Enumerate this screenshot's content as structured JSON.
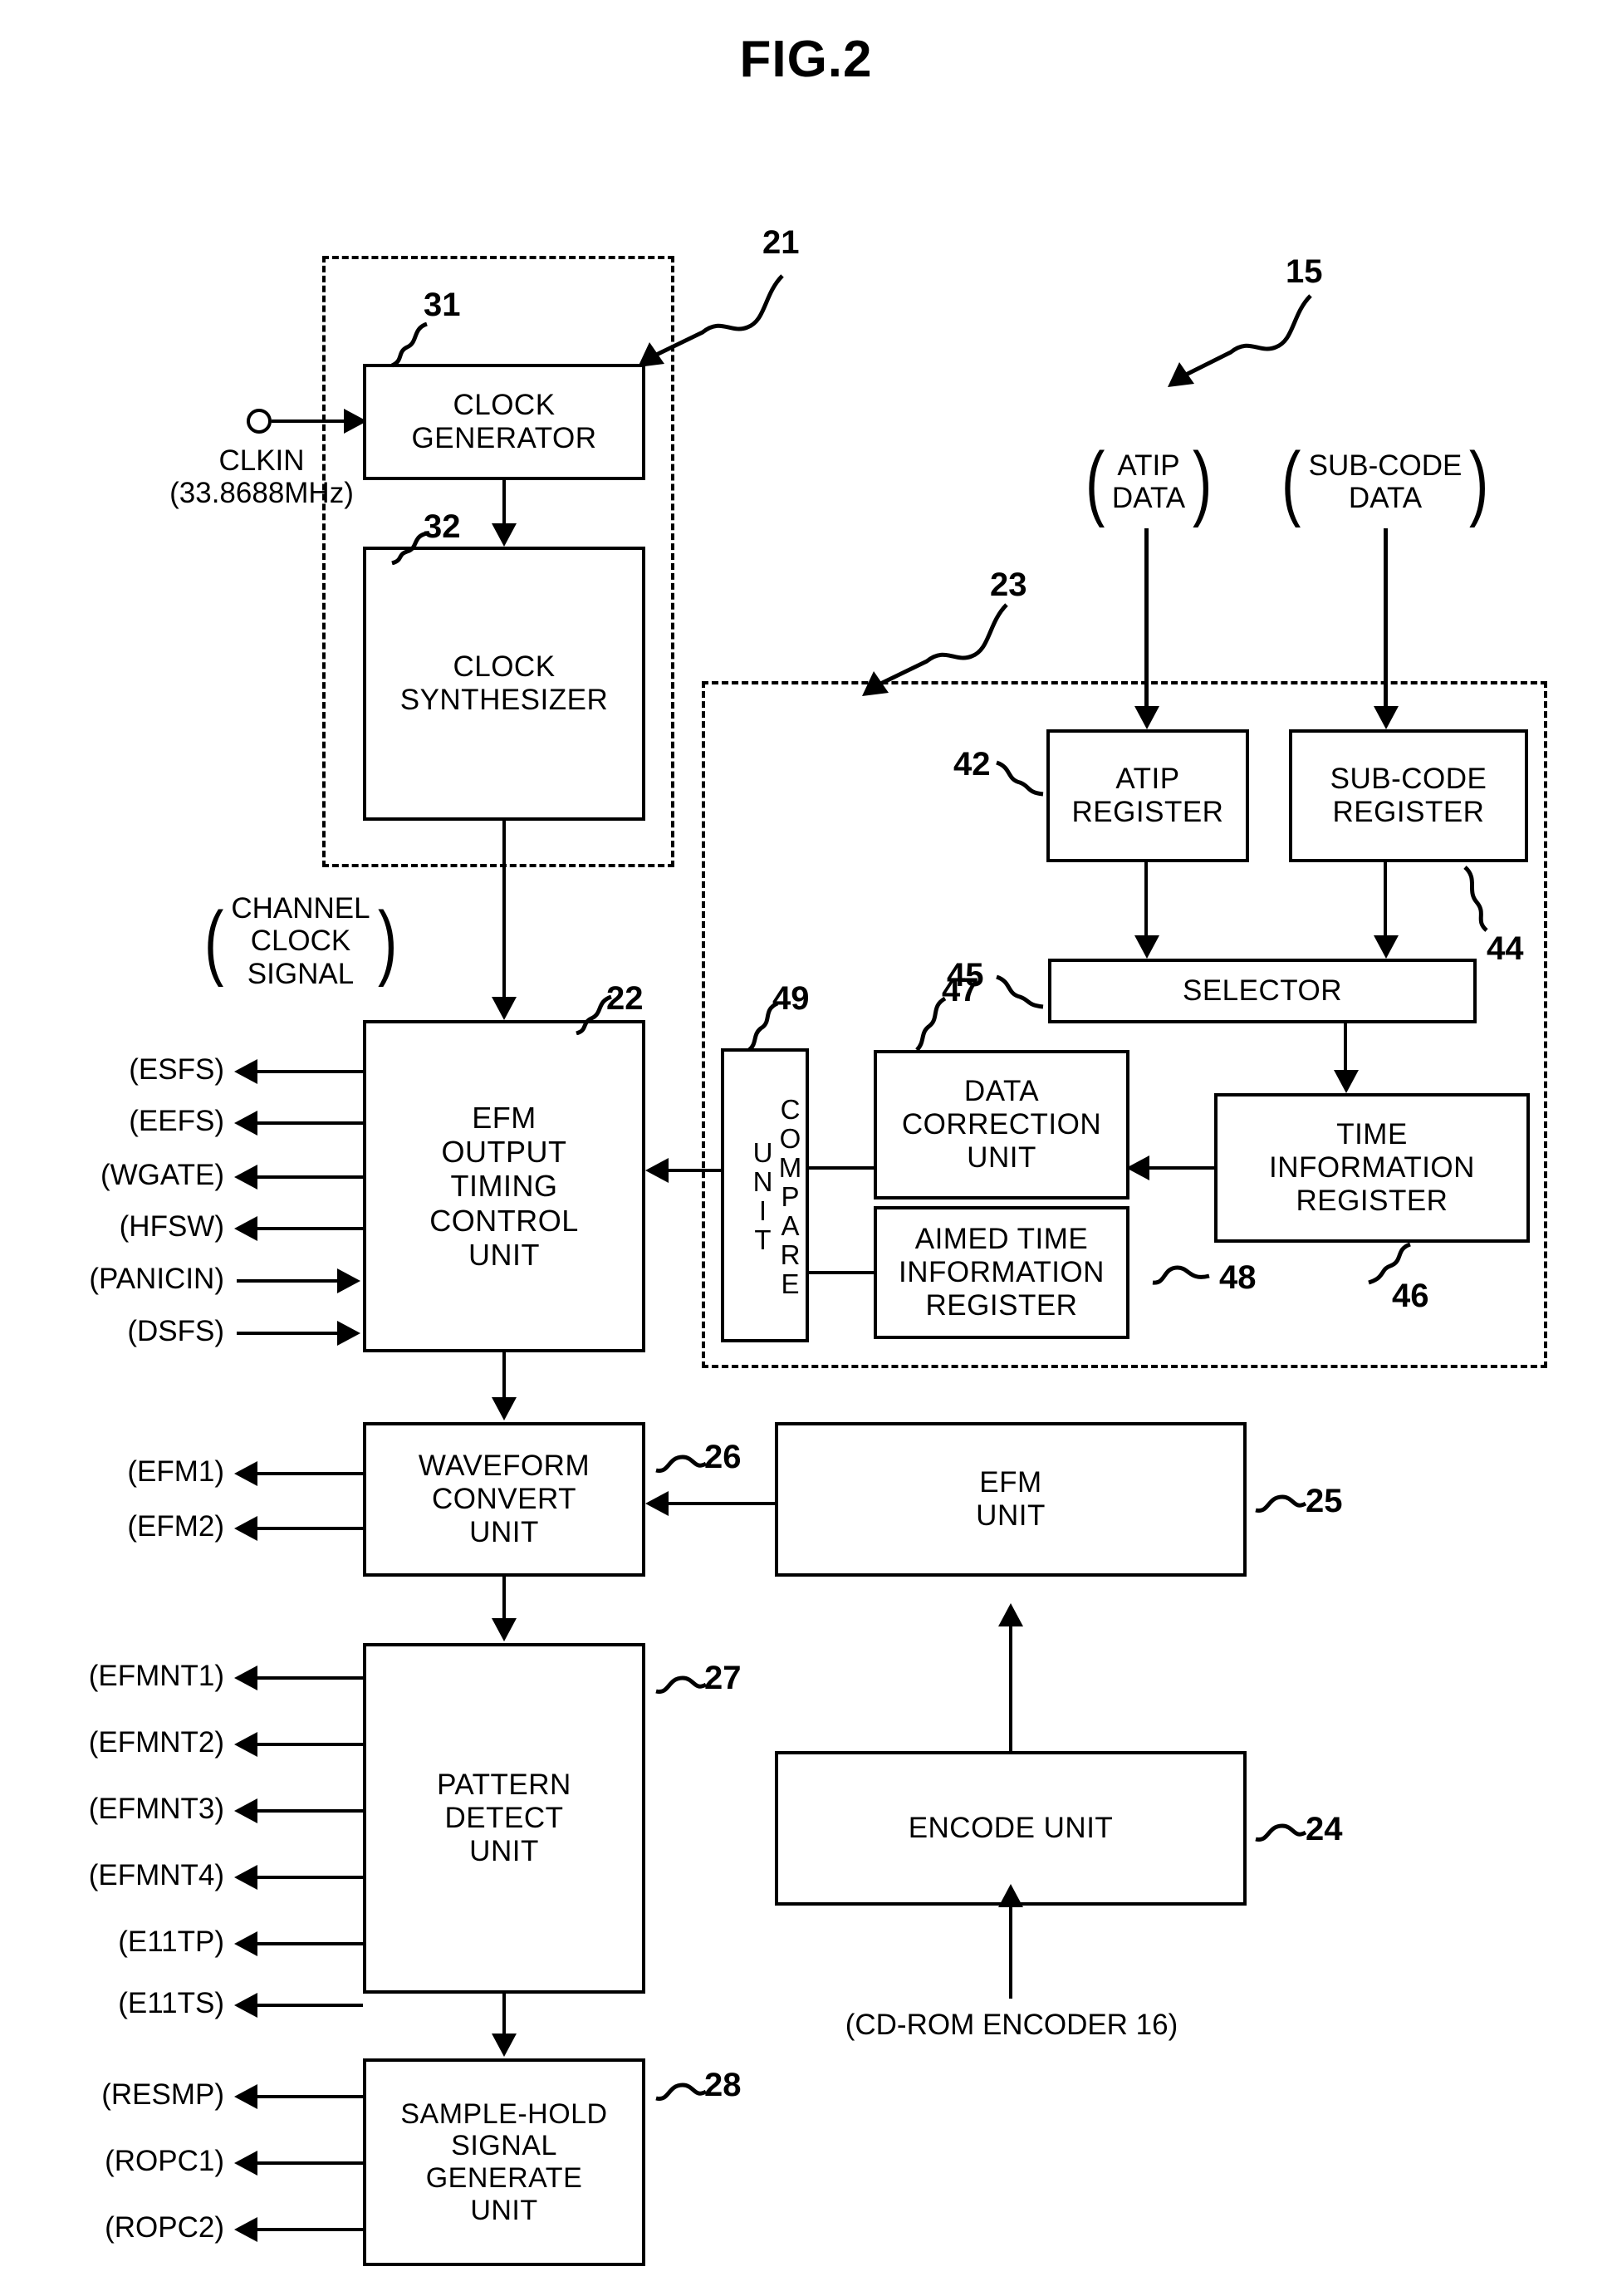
{
  "figure": {
    "title": "FIG.2"
  },
  "reference_numbers": {
    "n15": "15",
    "n21": "21",
    "n22": "22",
    "n23": "23",
    "n24": "24",
    "n25": "25",
    "n26": "26",
    "n27": "27",
    "n28": "28",
    "n31": "31",
    "n32": "32",
    "n42": "42",
    "n44": "44",
    "n45": "45",
    "n46": "46",
    "n47": "47",
    "n48": "48",
    "n49": "49"
  },
  "blocks": {
    "clock_generator": "CLOCK\nGENERATOR",
    "clock_generator_l1": "CLOCK",
    "clock_generator_l2": "GENERATOR",
    "clock_synthesizer_l1": "CLOCK",
    "clock_synthesizer_l2": "SYNTHESIZER",
    "efm_output_timing_l1": "EFM",
    "efm_output_timing_l2": "OUTPUT",
    "efm_output_timing_l3": "TIMING",
    "efm_output_timing_l4": "CONTROL",
    "efm_output_timing_l5": "UNIT",
    "waveform_convert_l1": "WAVEFORM",
    "waveform_convert_l2": "CONVERT",
    "waveform_convert_l3": "UNIT",
    "pattern_detect_l1": "PATTERN",
    "pattern_detect_l2": "DETECT",
    "pattern_detect_l3": "UNIT",
    "sample_hold_l1": "SAMPLE-HOLD",
    "sample_hold_l2": "SIGNAL",
    "sample_hold_l3": "GENERATE",
    "sample_hold_l4": "UNIT",
    "efm_unit_l1": "EFM",
    "efm_unit_l2": "UNIT",
    "encode_unit": "ENCODE UNIT",
    "atip_register_l1": "ATIP",
    "atip_register_l2": "REGISTER",
    "subcode_register_l1": "SUB-CODE",
    "subcode_register_l2": "REGISTER",
    "selector": "SELECTOR",
    "time_info_register_l1": "TIME",
    "time_info_register_l2": "INFORMATION",
    "time_info_register_l3": "REGISTER",
    "data_correction_l1": "DATA",
    "data_correction_l2": "CORRECTION",
    "data_correction_l3": "UNIT",
    "aimed_time_l1": "AIMED TIME",
    "aimed_time_l2": "INFORMATION",
    "aimed_time_l3": "REGISTER",
    "compare_unit": "COMPARE UNIT"
  },
  "signals": {
    "clkin_name": "CLKIN",
    "clkin_freq": "(33.8688MHz)",
    "channel_clock_l1": "CHANNEL",
    "channel_clock_l2": "CLOCK",
    "channel_clock_l3": "SIGNAL",
    "atip_data_l1": "ATIP",
    "atip_data_l2": "DATA",
    "subcode_data_l1": "SUB-CODE",
    "subcode_data_l2": "DATA",
    "cdrom_encoder": "(CD-ROM ENCODER 16)",
    "efm_timing_ports": [
      {
        "label": "(ESFS)",
        "direction": "out"
      },
      {
        "label": "(EEFS)",
        "direction": "out"
      },
      {
        "label": "(WGATE)",
        "direction": "out"
      },
      {
        "label": "(HFSW)",
        "direction": "out"
      },
      {
        "label": "(PANICIN)",
        "direction": "in"
      },
      {
        "label": "(DSFS)",
        "direction": "in"
      }
    ],
    "waveform_ports": [
      {
        "label": "(EFM1)",
        "direction": "out"
      },
      {
        "label": "(EFM2)",
        "direction": "out"
      }
    ],
    "pattern_ports": [
      {
        "label": "(EFMNT1)",
        "direction": "out"
      },
      {
        "label": "(EFMNT2)",
        "direction": "out"
      },
      {
        "label": "(EFMNT3)",
        "direction": "out"
      },
      {
        "label": "(EFMNT4)",
        "direction": "out"
      },
      {
        "label": "(E11TP)",
        "direction": "out"
      },
      {
        "label": "(E11TS)",
        "direction": "out"
      }
    ],
    "sample_hold_ports": [
      {
        "label": "(RESMP)",
        "direction": "out"
      },
      {
        "label": "(ROPC1)",
        "direction": "out"
      },
      {
        "label": "(ROPC2)",
        "direction": "out"
      }
    ]
  }
}
